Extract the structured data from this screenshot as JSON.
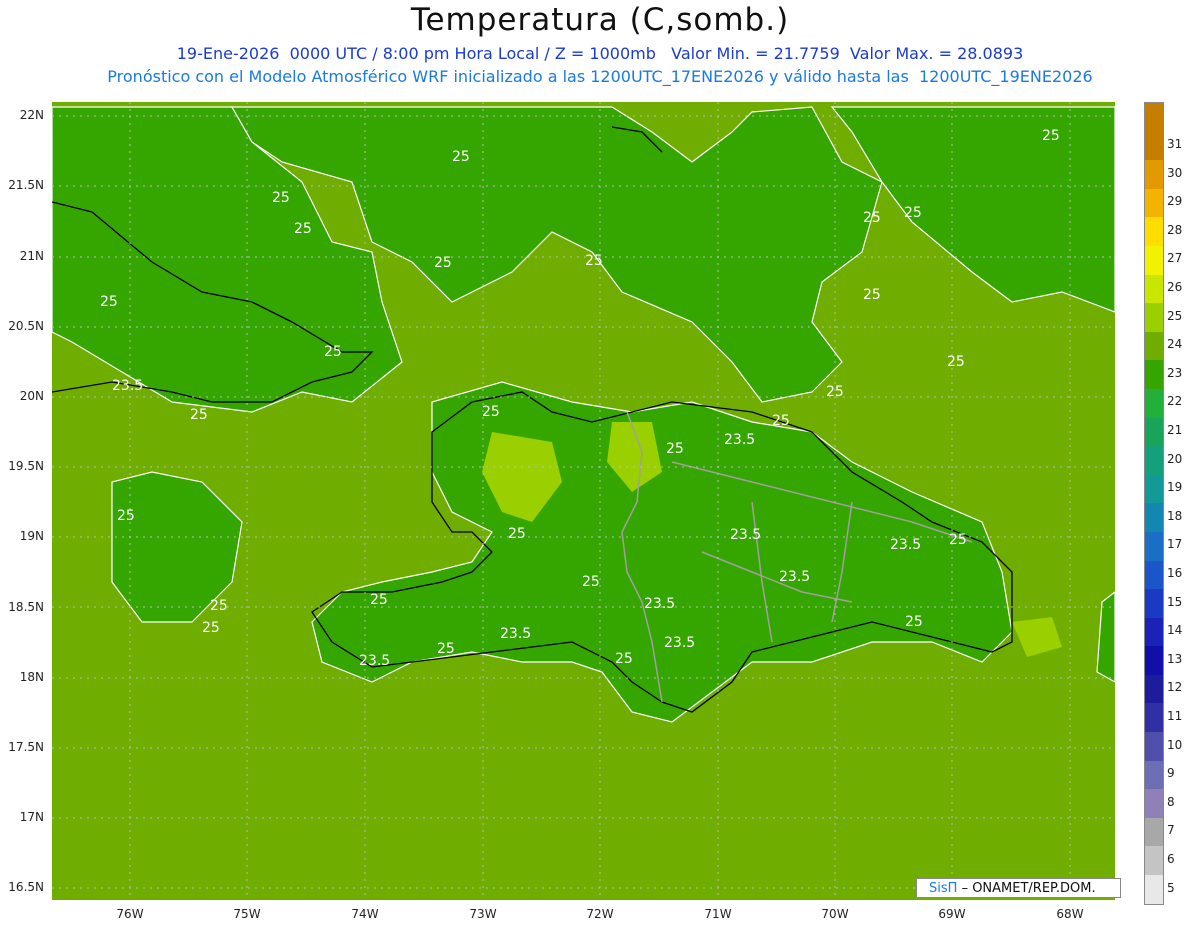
{
  "header": {
    "title": "Temperatura (C,somb.)",
    "line1": "19-Ene-2026  0000 UTC / 8:00 pm Hora Local / Z = 1000mb   Valor Min. = 21.7759  Valor Max. = 28.0893",
    "line2": "Pronóstico con el Modelo Atmosférico WRF inicializado a las 1200UTC_17ENE2026 y válido hasta las  1200UTC_19ENE2026"
  },
  "axes": {
    "lat_labels": [
      "22N",
      "21.5N",
      "21N",
      "20.5N",
      "20N",
      "19.5N",
      "19N",
      "18.5N",
      "18N",
      "17.5N",
      "17N",
      "16.5N"
    ],
    "lon_labels": [
      "76W",
      "75W",
      "74W",
      "73W",
      "72W",
      "71W",
      "70W",
      "69W",
      "68W"
    ]
  },
  "contour_labels": [
    "25",
    "23.5"
  ],
  "colorbar": {
    "labels": [
      "31",
      "30",
      "29",
      "28",
      "27",
      "26",
      "25",
      "24",
      "23",
      "22",
      "21",
      "20",
      "19",
      "18",
      "17",
      "16",
      "15",
      "14",
      "13",
      "12",
      "11",
      "10",
      "9",
      "8",
      "7",
      "6",
      "5"
    ],
    "colors": [
      "#c47f00",
      "#e39a00",
      "#f2b400",
      "#ffdd00",
      "#f2f200",
      "#c9e600",
      "#9ad000",
      "#6fae00",
      "#35a500",
      "#22b03a",
      "#1aa45a",
      "#14a07a",
      "#119a98",
      "#1487b0",
      "#1a6fc4",
      "#1a56c8",
      "#1a3ac4",
      "#1a22b8",
      "#1010a8",
      "#1c1c9c",
      "#3030a4",
      "#5050ac",
      "#6e6eb4",
      "#9080b8",
      "#a8a8a8",
      "#c4c4c4",
      "#e8e8e8"
    ],
    "top_color": "#c47f00"
  },
  "credit": {
    "brand": "SisΠ",
    "text": "– ONAMET/REP.DOM."
  }
}
